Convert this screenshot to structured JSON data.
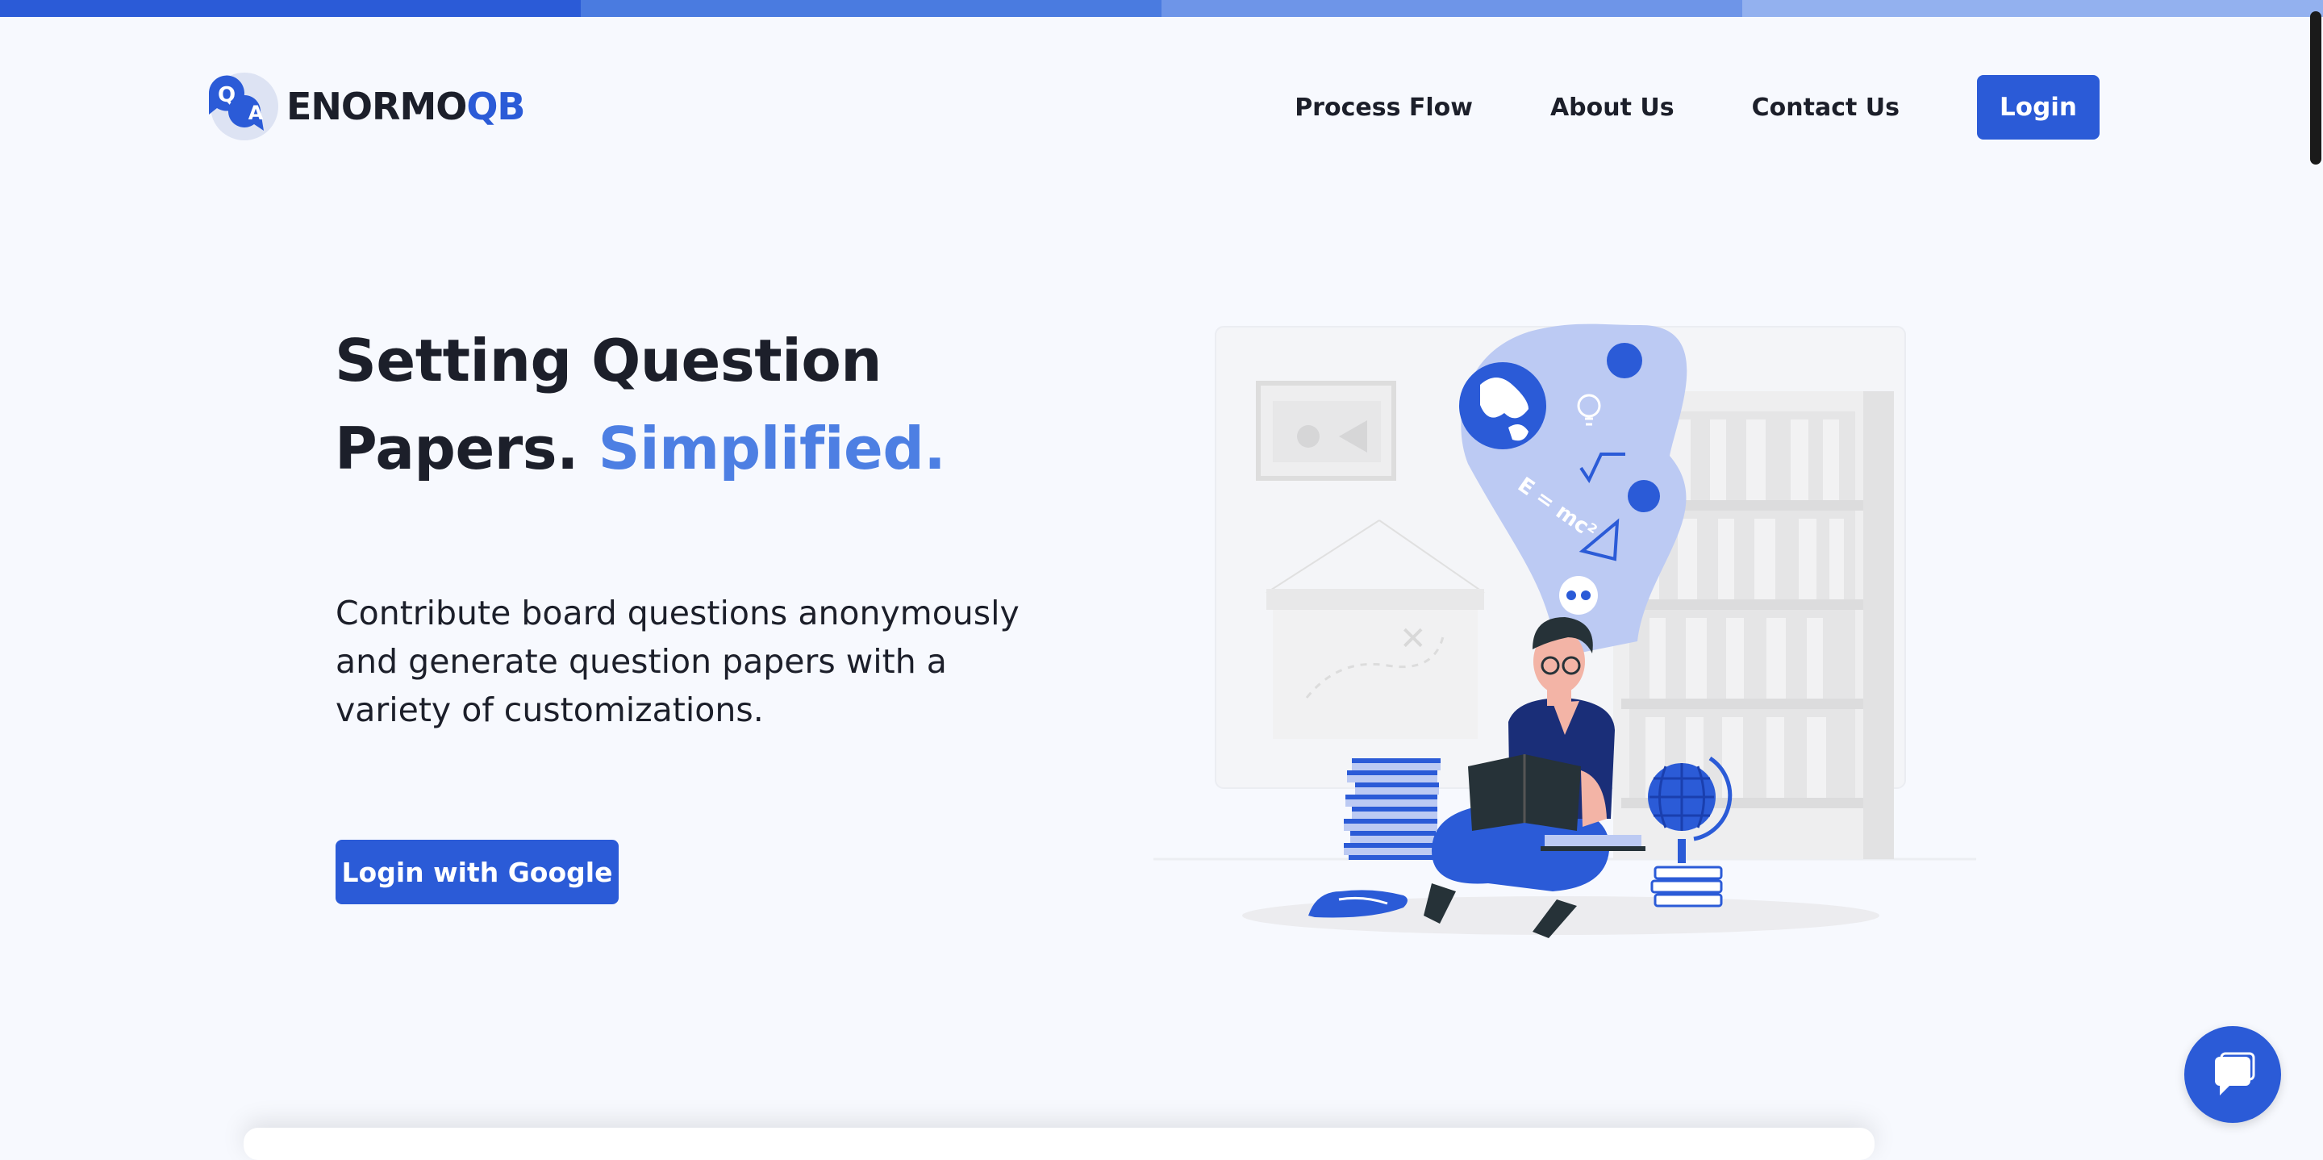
{
  "brand": {
    "logo_bubble_q": "Q",
    "logo_bubble_a": "A",
    "name_main": "ENORMO",
    "name_accent": "QB",
    "accent_color": "#2b5bd7"
  },
  "top_progress_colors": [
    "#2b5bd7",
    "#4a7be0",
    "#6e95e8",
    "#93b1ef"
  ],
  "nav": {
    "links": [
      "Process Flow",
      "About Us",
      "Contact Us"
    ],
    "login_label": "Login"
  },
  "hero": {
    "title_line1": "Setting Question",
    "title_line2_main": "Papers.",
    "title_line2_accent": "Simplified.",
    "description": "Contribute board questions anonymously and generate question papers with a variety of customizations.",
    "cta_label": "Login with Google"
  },
  "illustration": {
    "formula": "E = mc²"
  },
  "icons": [
    "qa-logo-icon",
    "chat-bubble-icon",
    "student-reading-illustration"
  ]
}
